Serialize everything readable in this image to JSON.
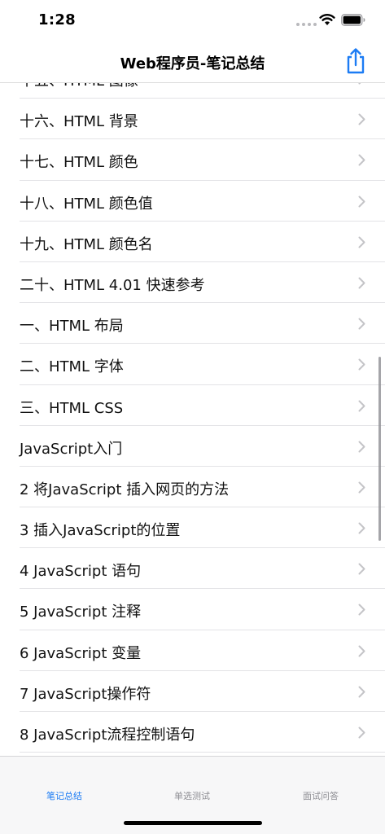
{
  "status_bar": {
    "time": "1:28"
  },
  "nav": {
    "title": "Web程序员-笔记总结",
    "share_icon": "share-icon"
  },
  "list": {
    "partial_top_label": "十五、HTML 图像",
    "items": [
      "十六、HTML 背景",
      "十七、HTML 颜色",
      "十八、HTML 颜色值",
      "十九、HTML 颜色名",
      "二十、HTML 4.01 快速参考",
      "一、HTML 布局",
      "二、HTML 字体",
      "三、HTML CSS",
      "JavaScript入门",
      "2 将JavaScript 插入网页的方法",
      "3 插入JavaScript的位置",
      "4  JavaScript 语句",
      "5 JavaScript 注释",
      "6 JavaScript 变量",
      "7 JavaScript操作符",
      "8 JavaScript流程控制语句"
    ]
  },
  "tabs": [
    {
      "label": "笔记总结",
      "active": true
    },
    {
      "label": "单选测试",
      "active": false
    },
    {
      "label": "面试问答",
      "active": false
    }
  ],
  "colors": {
    "accent": "#1c7cf4",
    "inactive": "#8e8e93",
    "separator": "#e3e3e6"
  }
}
